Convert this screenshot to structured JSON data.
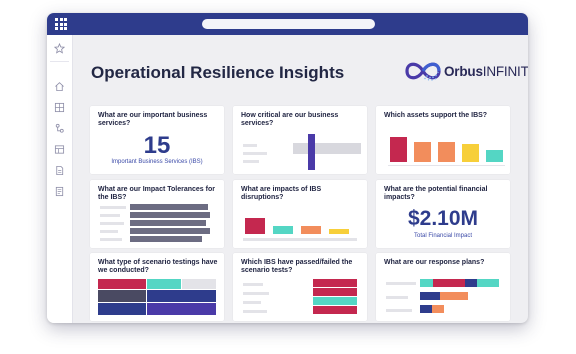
{
  "page": {
    "title": "Operational Resilience Insights"
  },
  "logo": {
    "bold": "Orbus",
    "light": "INFINITY"
  },
  "sidebar": {
    "icons": [
      "star-icon",
      "home-icon",
      "grid-view-icon",
      "hierarchy-icon",
      "catalog-icon",
      "document-icon",
      "notes-icon"
    ]
  },
  "colors": {
    "navy": "#2e3c8c",
    "indigo": "#4a3aa8",
    "gray": "#d8d8de",
    "crimson": "#c4284f",
    "teal": "#54d6c4",
    "orange": "#f28d5c",
    "yellow": "#f7cf3a",
    "slate": "#6c6c82"
  },
  "cards": [
    {
      "id": "ibs",
      "question": "What are our important business services?",
      "value": "15",
      "caption": "Important Business Services (IBS)"
    },
    {
      "id": "criticality",
      "question": "How critical are our business services?"
    },
    {
      "id": "assets",
      "question": "Which assets support the IBS?"
    },
    {
      "id": "tolerances",
      "question": "What are our Impact Tolerances for the IBS?"
    },
    {
      "id": "impacts",
      "question": "What are impacts of IBS disruptions?"
    },
    {
      "id": "financial",
      "question": "What are the potential financial impacts?",
      "value": "$2.10M",
      "caption": "Total Financial Impact"
    },
    {
      "id": "scenarios",
      "question": "What type of scenario testings have we conducted?"
    },
    {
      "id": "tests",
      "question": "Which IBS have passed/failed the scenario tests?"
    },
    {
      "id": "response",
      "question": "What are our response plans?"
    }
  ]
}
